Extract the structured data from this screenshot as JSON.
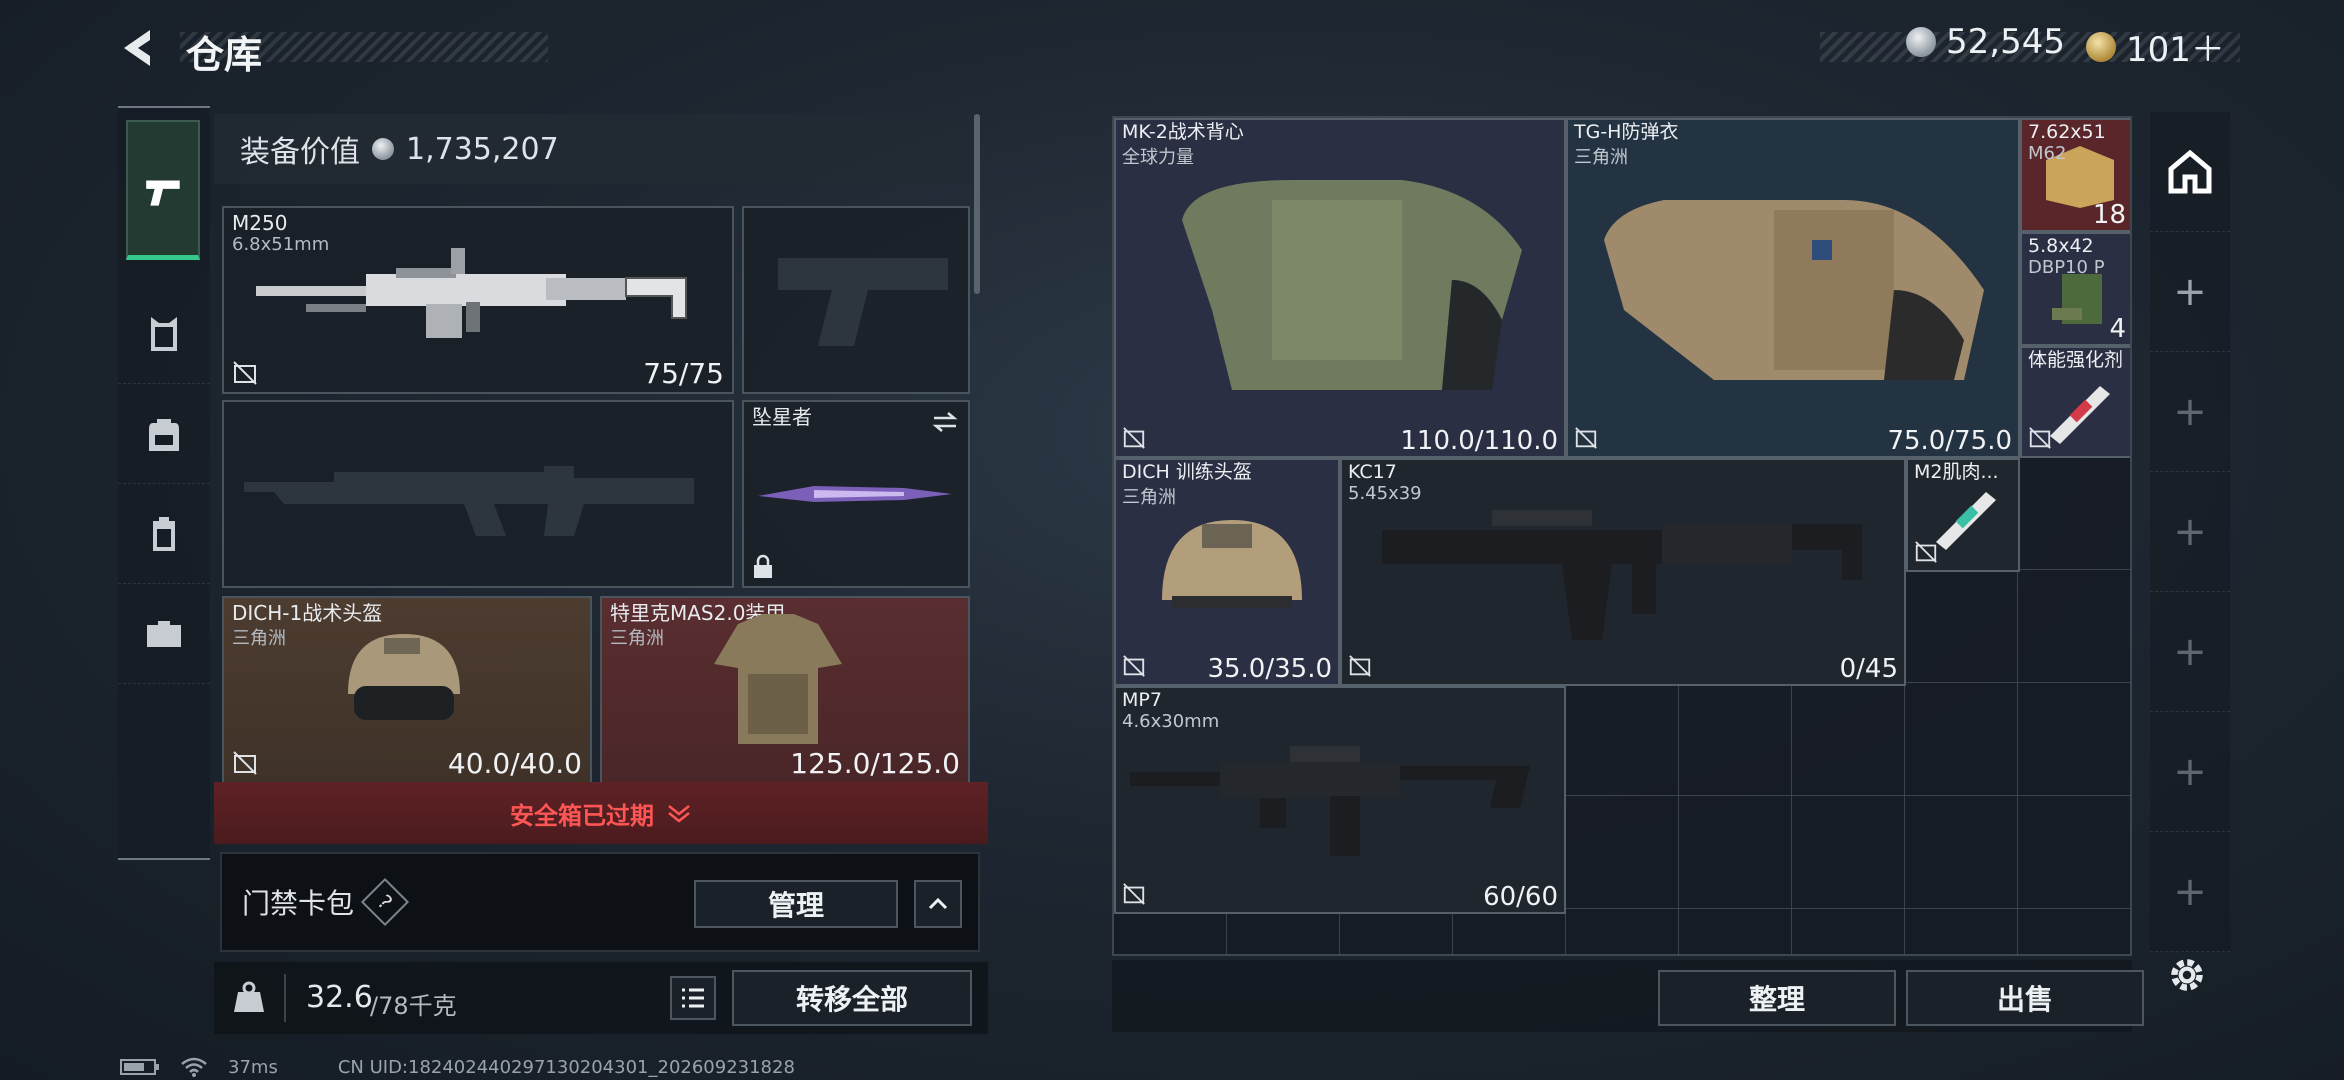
{
  "header": {
    "title": "仓库",
    "currency1": "52,545",
    "currency2": "101＋"
  },
  "equip": {
    "label": "装备价值",
    "value": "1,735,207"
  },
  "slots": {
    "m250": {
      "name": "M250",
      "caliber": "6.8x51mm",
      "ammo": "75/75"
    },
    "melee": {
      "name": "坠星者"
    },
    "helmet": {
      "name": "DICH-1战术头盔",
      "brand": "三角洲",
      "durability": "40.0/40.0"
    },
    "armor": {
      "name": "特里克MAS2.0装甲",
      "brand": "三角洲",
      "durability": "125.0/125.0"
    }
  },
  "safe_box": {
    "text": "安全箱已过期"
  },
  "keycard": {
    "label": "门禁卡包",
    "help": "?",
    "manage": "管理"
  },
  "weight": {
    "current": "32.6",
    "max": "/78千克"
  },
  "buttons": {
    "transfer_all": "转移全部",
    "sort": "整理",
    "sell": "出售"
  },
  "stash": [
    {
      "name": "MK-2战术背心",
      "sub": "全球力量",
      "val": "110.0/110.0"
    },
    {
      "name": "TG-H防弹衣",
      "sub": "三角洲",
      "val": "75.0/75.0"
    },
    {
      "name": "7.62x51",
      "sub": "M62",
      "val": "18"
    },
    {
      "name": "5.8x42",
      "sub": "DBP10 P",
      "val": "4"
    },
    {
      "name": "体能强化剂",
      "sub": "",
      "val": ""
    },
    {
      "name": "DICH 训练头盔",
      "sub": "三角洲",
      "val": "35.0/35.0"
    },
    {
      "name": "KC17",
      "sub": "5.45x39",
      "val": "0/45"
    },
    {
      "name": "M2肌肉...",
      "sub": "",
      "val": ""
    },
    {
      "name": "MP7",
      "sub": "4.6x30mm",
      "val": "60/60"
    }
  ],
  "status": {
    "ping": "37ms",
    "uid": "CN UID:18240244029713020430​1_202609231828"
  },
  "colors": {
    "accent": "#35c88a",
    "danger": "#ff5555",
    "red_bg": "#5a2e30"
  },
  "icons": [
    "back-icon",
    "silver-coin-icon",
    "gold-coin-icon",
    "pistol-icon",
    "vest-icon",
    "backpack-icon",
    "clipboard-icon",
    "toolbox-icon",
    "no-insure-icon",
    "swap-icon",
    "lock-icon",
    "chevron-down-icon",
    "chevron-up-icon",
    "list-icon",
    "home-icon",
    "plus-icon",
    "gear-icon",
    "battery-icon",
    "wifi-icon"
  ]
}
